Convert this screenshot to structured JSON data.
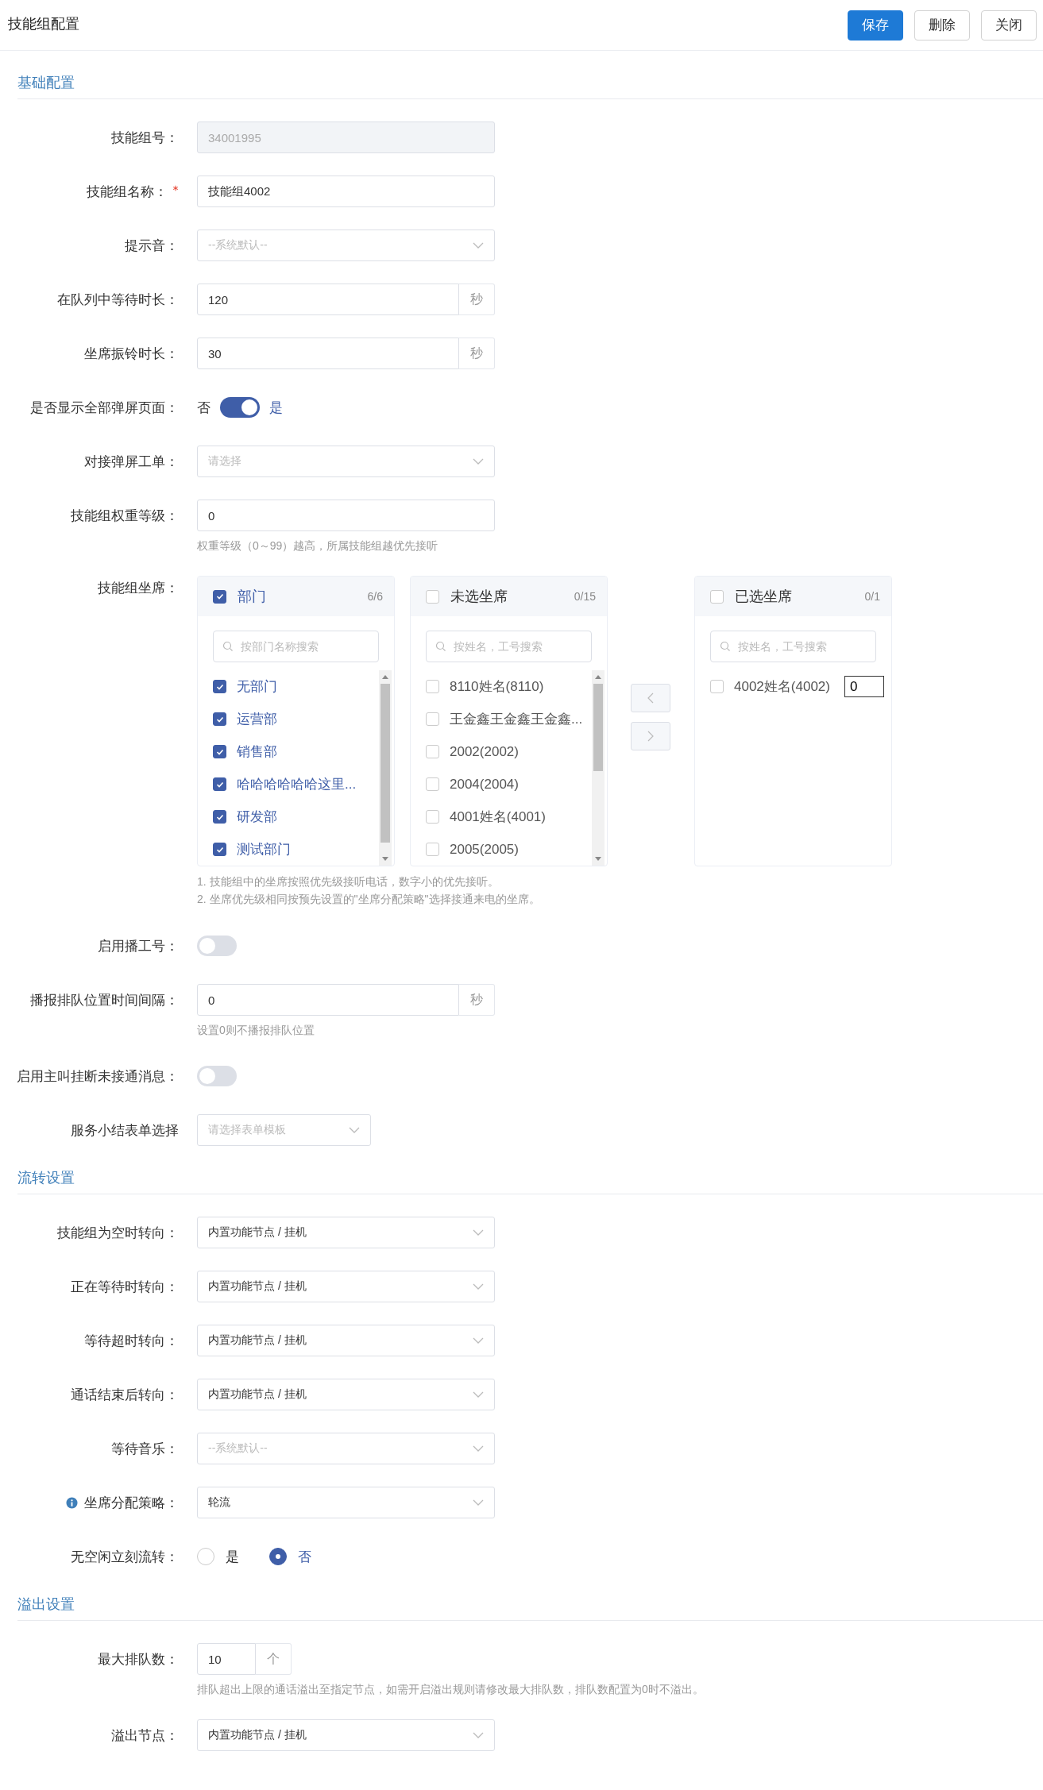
{
  "header": {
    "title": "技能组配置",
    "buttons": [
      {
        "label": "保存",
        "kind": "primary"
      },
      {
        "label": "删除",
        "kind": "default"
      },
      {
        "label": "关闭",
        "kind": "default"
      }
    ]
  },
  "sections": [
    {
      "title": "基础配置",
      "rows": [
        {
          "kind": "input",
          "label": "技能组号：",
          "value": "34001995",
          "disabled": true
        },
        {
          "kind": "input",
          "label": "技能组名称：",
          "required": true,
          "value": "技能组4002",
          "disabled": false
        },
        {
          "kind": "select",
          "label": "提示音：",
          "placeholder": "--系统默认--"
        },
        {
          "kind": "input",
          "label": "在队列中等待时长：",
          "value": "120",
          "suffix": "秒",
          "disabled": false
        },
        {
          "kind": "input",
          "label": "坐席振铃时长：",
          "value": "30",
          "suffix": "秒",
          "disabled": false
        },
        {
          "kind": "switch",
          "label": "是否显示全部弹屏页面：",
          "off_label": "否",
          "on_label": "是",
          "on": true
        },
        {
          "kind": "select",
          "label": "对接弹屏工单：",
          "placeholder": "请选择"
        },
        {
          "kind": "input",
          "label": "技能组权重等级：",
          "value": "0",
          "disabled": false,
          "hint": "权重等级（0～99）越高，所属技能组越优先接听"
        },
        {
          "kind": "transfer",
          "label": "技能组坐席：",
          "panels": [
            {
              "title": "部门",
              "count": "6/6",
              "checked": true,
              "search_placeholder": "按部门名称搜索",
              "items": [
                {
                  "label": "无部门",
                  "checked": true
                },
                {
                  "label": "运营部",
                  "checked": true
                },
                {
                  "label": "销售部",
                  "checked": true
                },
                {
                  "label": "哈哈哈哈哈哈这里...",
                  "checked": true
                },
                {
                  "label": "研发部",
                  "checked": true
                },
                {
                  "label": "测试部门",
                  "checked": true
                }
              ]
            },
            {
              "title": "未选坐席",
              "count": "0/15",
              "checked": false,
              "search_placeholder": "按姓名，工号搜索",
              "items": [
                {
                  "label": "8110姓名(8110)",
                  "checked": false
                },
                {
                  "label": "王金鑫王金鑫王金鑫...",
                  "checked": false
                },
                {
                  "label": "2002(2002)",
                  "checked": false
                },
                {
                  "label": "2004(2004)",
                  "checked": false
                },
                {
                  "label": "4001姓名(4001)",
                  "checked": false
                },
                {
                  "label": "2005(2005)",
                  "checked": false
                }
              ]
            },
            {
              "title": "已选坐席",
              "count": "0/1",
              "checked": false,
              "search_placeholder": "按姓名，工号搜索",
              "items": [
                {
                  "label": "4002姓名(4002)",
                  "checked": false,
                  "priority": "0"
                }
              ]
            }
          ],
          "buttons": [
            {
              "kind": "left",
              "disabled": true
            },
            {
              "kind": "right",
              "disabled": true
            }
          ],
          "notes": [
            "1. 技能组中的坐席按照优先级接听电话，数字小的优先接听。",
            "2. 坐席优先级相同按预先设置的\"坐席分配策略\"选择接通来电的坐席。"
          ]
        },
        {
          "kind": "switch",
          "label": "启用播工号：",
          "on": false
        },
        {
          "kind": "input",
          "label": "播报排队位置时间间隔：",
          "value": "0",
          "suffix": "秒",
          "disabled": false,
          "hint": "设置0则不播报排队位置"
        },
        {
          "kind": "switch",
          "label": "启用主叫挂断未接通消息：",
          "on": false
        },
        {
          "kind": "select",
          "label": "服务小结表单选择",
          "placeholder": "请选择表单模板",
          "compact": true
        }
      ]
    },
    {
      "title": "流转设置",
      "rows": [
        {
          "kind": "select",
          "label": "技能组为空时转向：",
          "value": "内置功能节点 / 挂机"
        },
        {
          "kind": "select",
          "label": "正在等待时转向：",
          "value": "内置功能节点 / 挂机"
        },
        {
          "kind": "select",
          "label": "等待超时转向：",
          "value": "内置功能节点 / 挂机"
        },
        {
          "kind": "select",
          "label": "通话结束后转向：",
          "value": "内置功能节点 / 挂机"
        },
        {
          "kind": "select",
          "label": "等待音乐：",
          "placeholder": "--系统默认--"
        },
        {
          "kind": "select",
          "label": "坐席分配策略：",
          "info": true,
          "value": "轮流"
        },
        {
          "kind": "radio",
          "label": "无空闲立刻流转：",
          "options": [
            {
              "label": "是",
              "selected": false
            },
            {
              "label": "否",
              "selected": true
            }
          ]
        }
      ]
    },
    {
      "title": "溢出设置",
      "rows": [
        {
          "kind": "input",
          "label": "最大排队数：",
          "value": "10",
          "suffix": "个",
          "compact": true,
          "disabled": false,
          "hint": "排队超出上限的通话溢出至指定节点，如需开启溢出规则请修改最大排队数，排队数配置为0时不溢出。"
        },
        {
          "kind": "select",
          "label": "溢出节点：",
          "value": "内置功能节点 / 挂机"
        }
      ]
    }
  ]
}
